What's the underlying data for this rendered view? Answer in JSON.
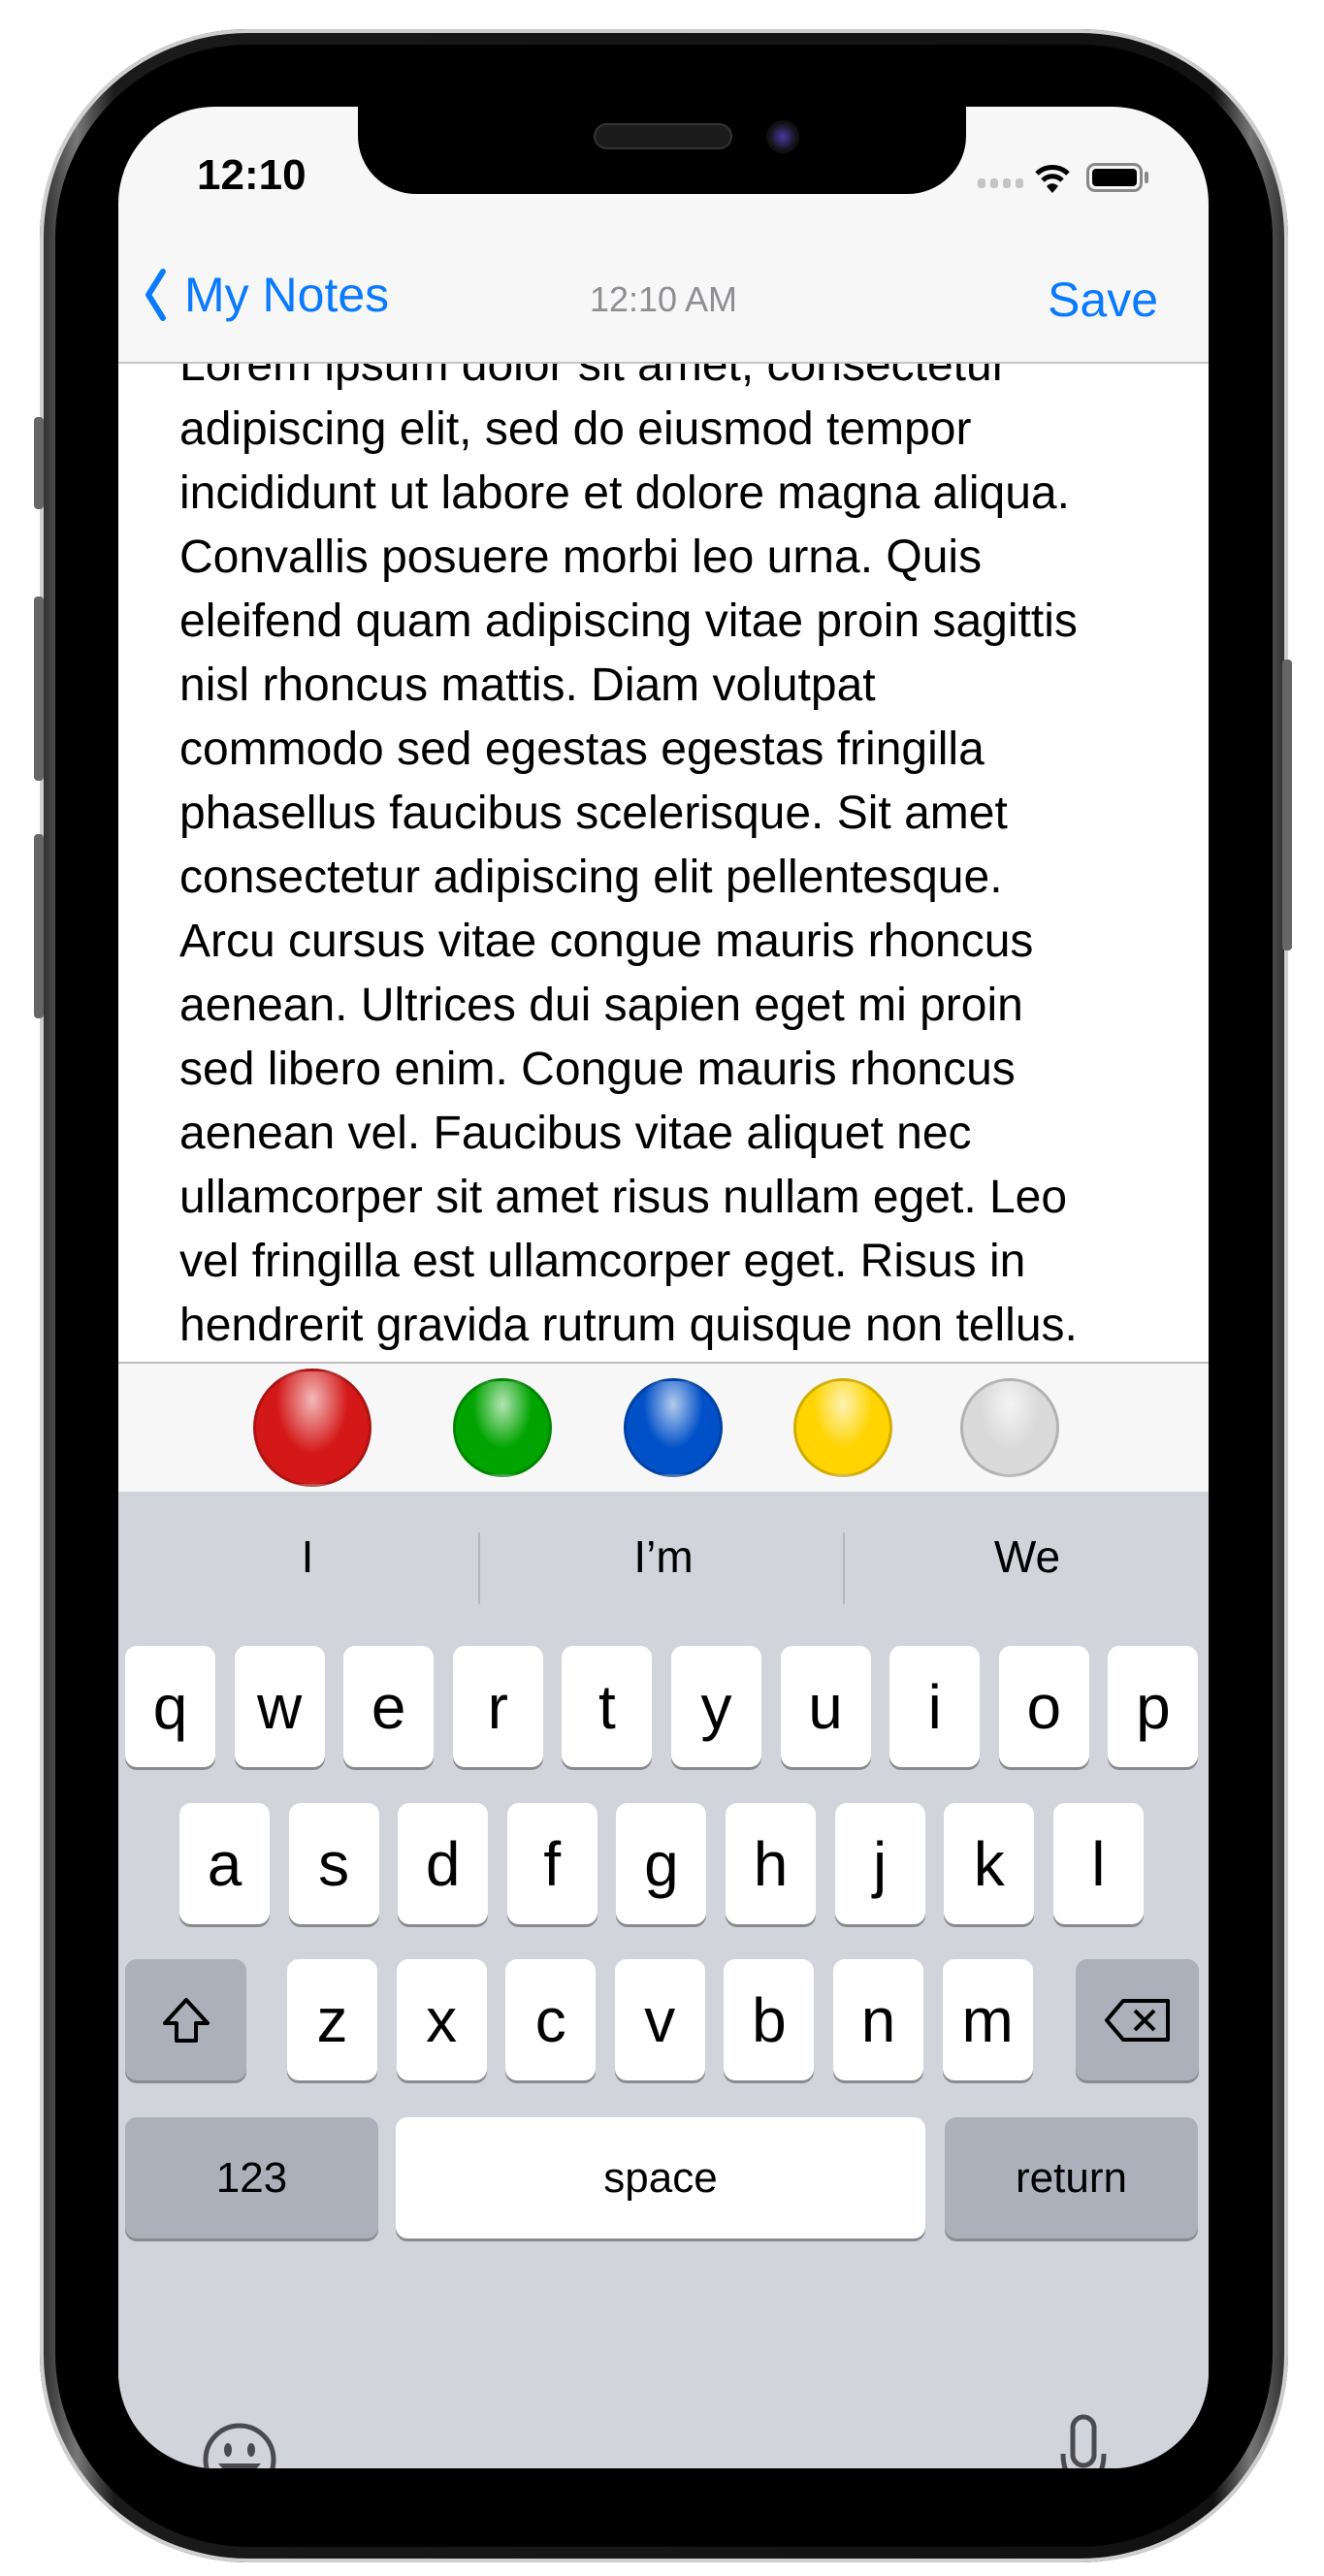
{
  "status_bar": {
    "time": "12:10"
  },
  "nav": {
    "back_label": "My Notes",
    "timestamp": "12:10 AM",
    "save_label": "Save"
  },
  "note_lines": [
    "Lorem ipsum dolor sit amet, consectetur",
    "adipiscing elit, sed do eiusmod tempor",
    "incididunt ut labore et dolore magna aliqua.",
    "Convallis posuere morbi leo urna. Quis",
    "eleifend quam adipiscing vitae proin sagittis",
    "nisl rhoncus mattis. Diam volutpat",
    "commodo sed egestas egestas fringilla",
    "phasellus faucibus scelerisque. Sit amet",
    "consectetur adipiscing elit pellentesque.",
    "Arcu cursus vitae congue mauris rhoncus",
    "aenean. Ultrices dui sapien eget mi proin",
    "sed libero enim. Congue mauris rhoncus",
    "aenean vel. Faucibus vitae aliquet nec",
    "ullamcorper sit amet risus nullam eget. Leo",
    "vel fringilla est ullamcorper eget. Risus in",
    "hendrerit gravida rutrum quisque non tellus."
  ],
  "colors": [
    {
      "name": "red",
      "hex": "#d41818",
      "selected": true
    },
    {
      "name": "green",
      "hex": "#00a400",
      "selected": false
    },
    {
      "name": "blue",
      "hex": "#0050c8",
      "selected": false
    },
    {
      "name": "yellow",
      "hex": "#ffd400",
      "selected": false
    },
    {
      "name": "white",
      "hex": "#dadada",
      "selected": false
    }
  ],
  "suggestions": [
    "I",
    "I’m",
    "We"
  ],
  "keyboard": {
    "row1": [
      "q",
      "w",
      "e",
      "r",
      "t",
      "y",
      "u",
      "i",
      "o",
      "p"
    ],
    "row2": [
      "a",
      "s",
      "d",
      "f",
      "g",
      "h",
      "j",
      "k",
      "l"
    ],
    "row3": [
      "z",
      "x",
      "c",
      "v",
      "b",
      "n",
      "m"
    ],
    "numbers_label": "123",
    "space_label": "space",
    "return_label": "return"
  }
}
